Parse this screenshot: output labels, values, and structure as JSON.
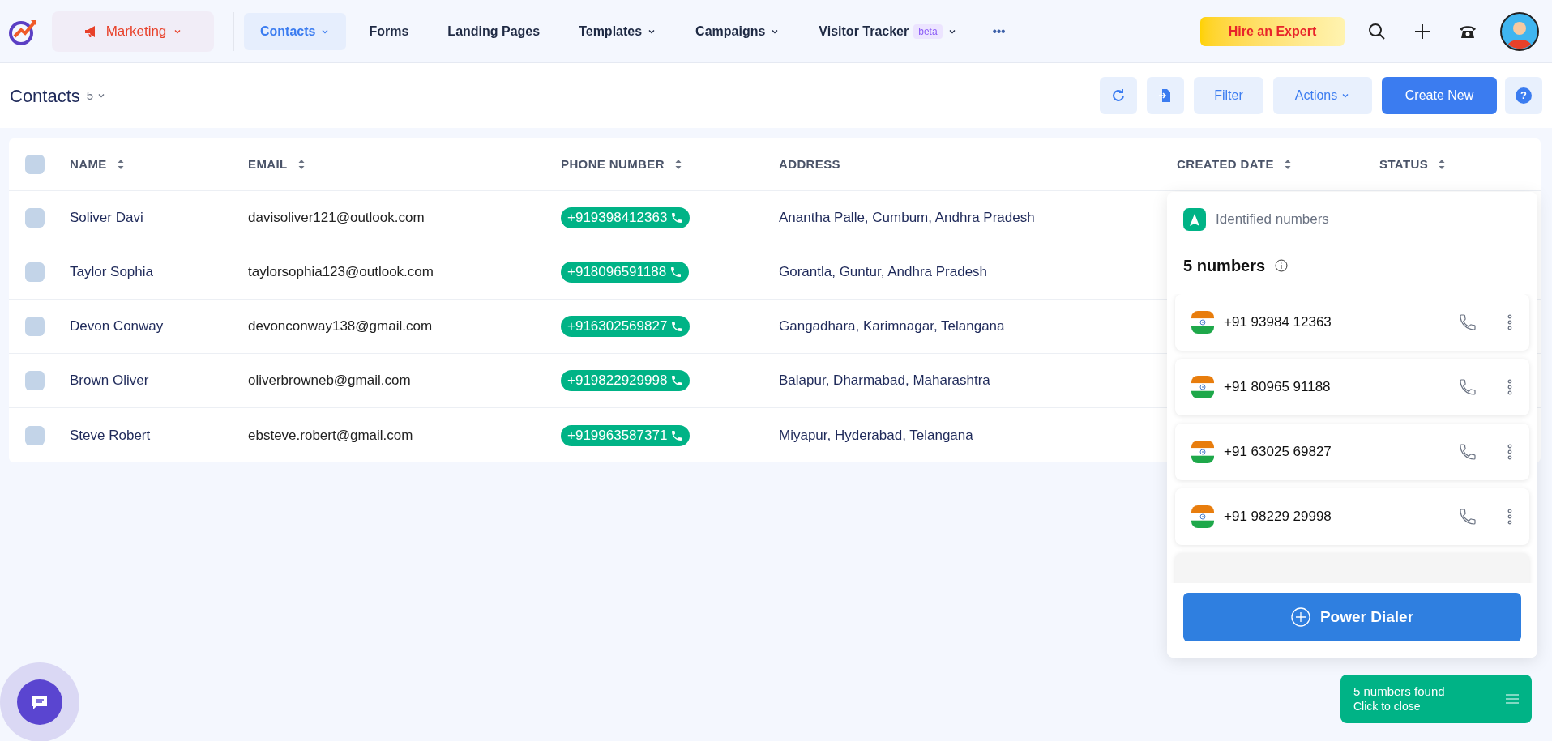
{
  "nav": {
    "workspace": "Marketing",
    "items": [
      {
        "label": "Contacts",
        "dropdown": true,
        "selected": true
      },
      {
        "label": "Forms",
        "dropdown": false,
        "selected": false
      },
      {
        "label": "Landing Pages",
        "dropdown": false,
        "selected": false
      },
      {
        "label": "Templates",
        "dropdown": true,
        "selected": false
      },
      {
        "label": "Campaigns",
        "dropdown": true,
        "selected": false
      },
      {
        "label": "Visitor Tracker",
        "badge": "beta",
        "dropdown": true,
        "selected": false
      }
    ],
    "more": "•••",
    "hire": "Hire an Expert"
  },
  "header": {
    "title": "Contacts",
    "count": "5",
    "filter": "Filter",
    "actions": "Actions",
    "create": "Create New",
    "help": "?"
  },
  "table": {
    "all_checked": false,
    "columns": [
      {
        "label": "NAME",
        "sortable": true
      },
      {
        "label": "EMAIL",
        "sortable": true
      },
      {
        "label": "PHONE NUMBER",
        "sortable": true
      },
      {
        "label": "ADDRESS",
        "sortable": false
      },
      {
        "label": "CREATED DATE",
        "sortable": true
      },
      {
        "label": "STATUS",
        "sortable": true
      }
    ],
    "rows": [
      {
        "checked": false,
        "name": "Soliver Davi",
        "email": "davisoliver121@outlook.com",
        "phone": "+919398412363",
        "address": "Anantha Palle, Cumbum, Andhra Pradesh"
      },
      {
        "checked": false,
        "name": "Taylor Sophia",
        "email": "taylorsophia123@outlook.com",
        "phone": "+918096591188",
        "address": "Gorantla, Guntur, Andhra Pradesh"
      },
      {
        "checked": false,
        "name": "Devon Conway",
        "email": "devonconway138@gmail.com",
        "phone": "+916302569827",
        "address": "Gangadhara, Karimnagar, Telangana"
      },
      {
        "checked": false,
        "name": "Brown Oliver",
        "email": "oliverbrowneb@gmail.com",
        "phone": "+919822929998",
        "address": "Balapur, Dharmabad, Maharashtra"
      },
      {
        "checked": false,
        "name": "Steve Robert",
        "email": "ebsteve.robert@gmail.com",
        "phone": "+919963587371",
        "address": "Miyapur, Hyderabad, Telangana"
      }
    ]
  },
  "panel": {
    "title": "Identified numbers",
    "count": "5 numbers",
    "numbers": [
      "+91 93984 12363",
      "+91 80965 91188",
      "+91 63025 69827",
      "+91 98229 29998"
    ],
    "button": "Power Dialer"
  },
  "toast": {
    "title": "5 numbers found",
    "subtitle": "Click to close"
  }
}
